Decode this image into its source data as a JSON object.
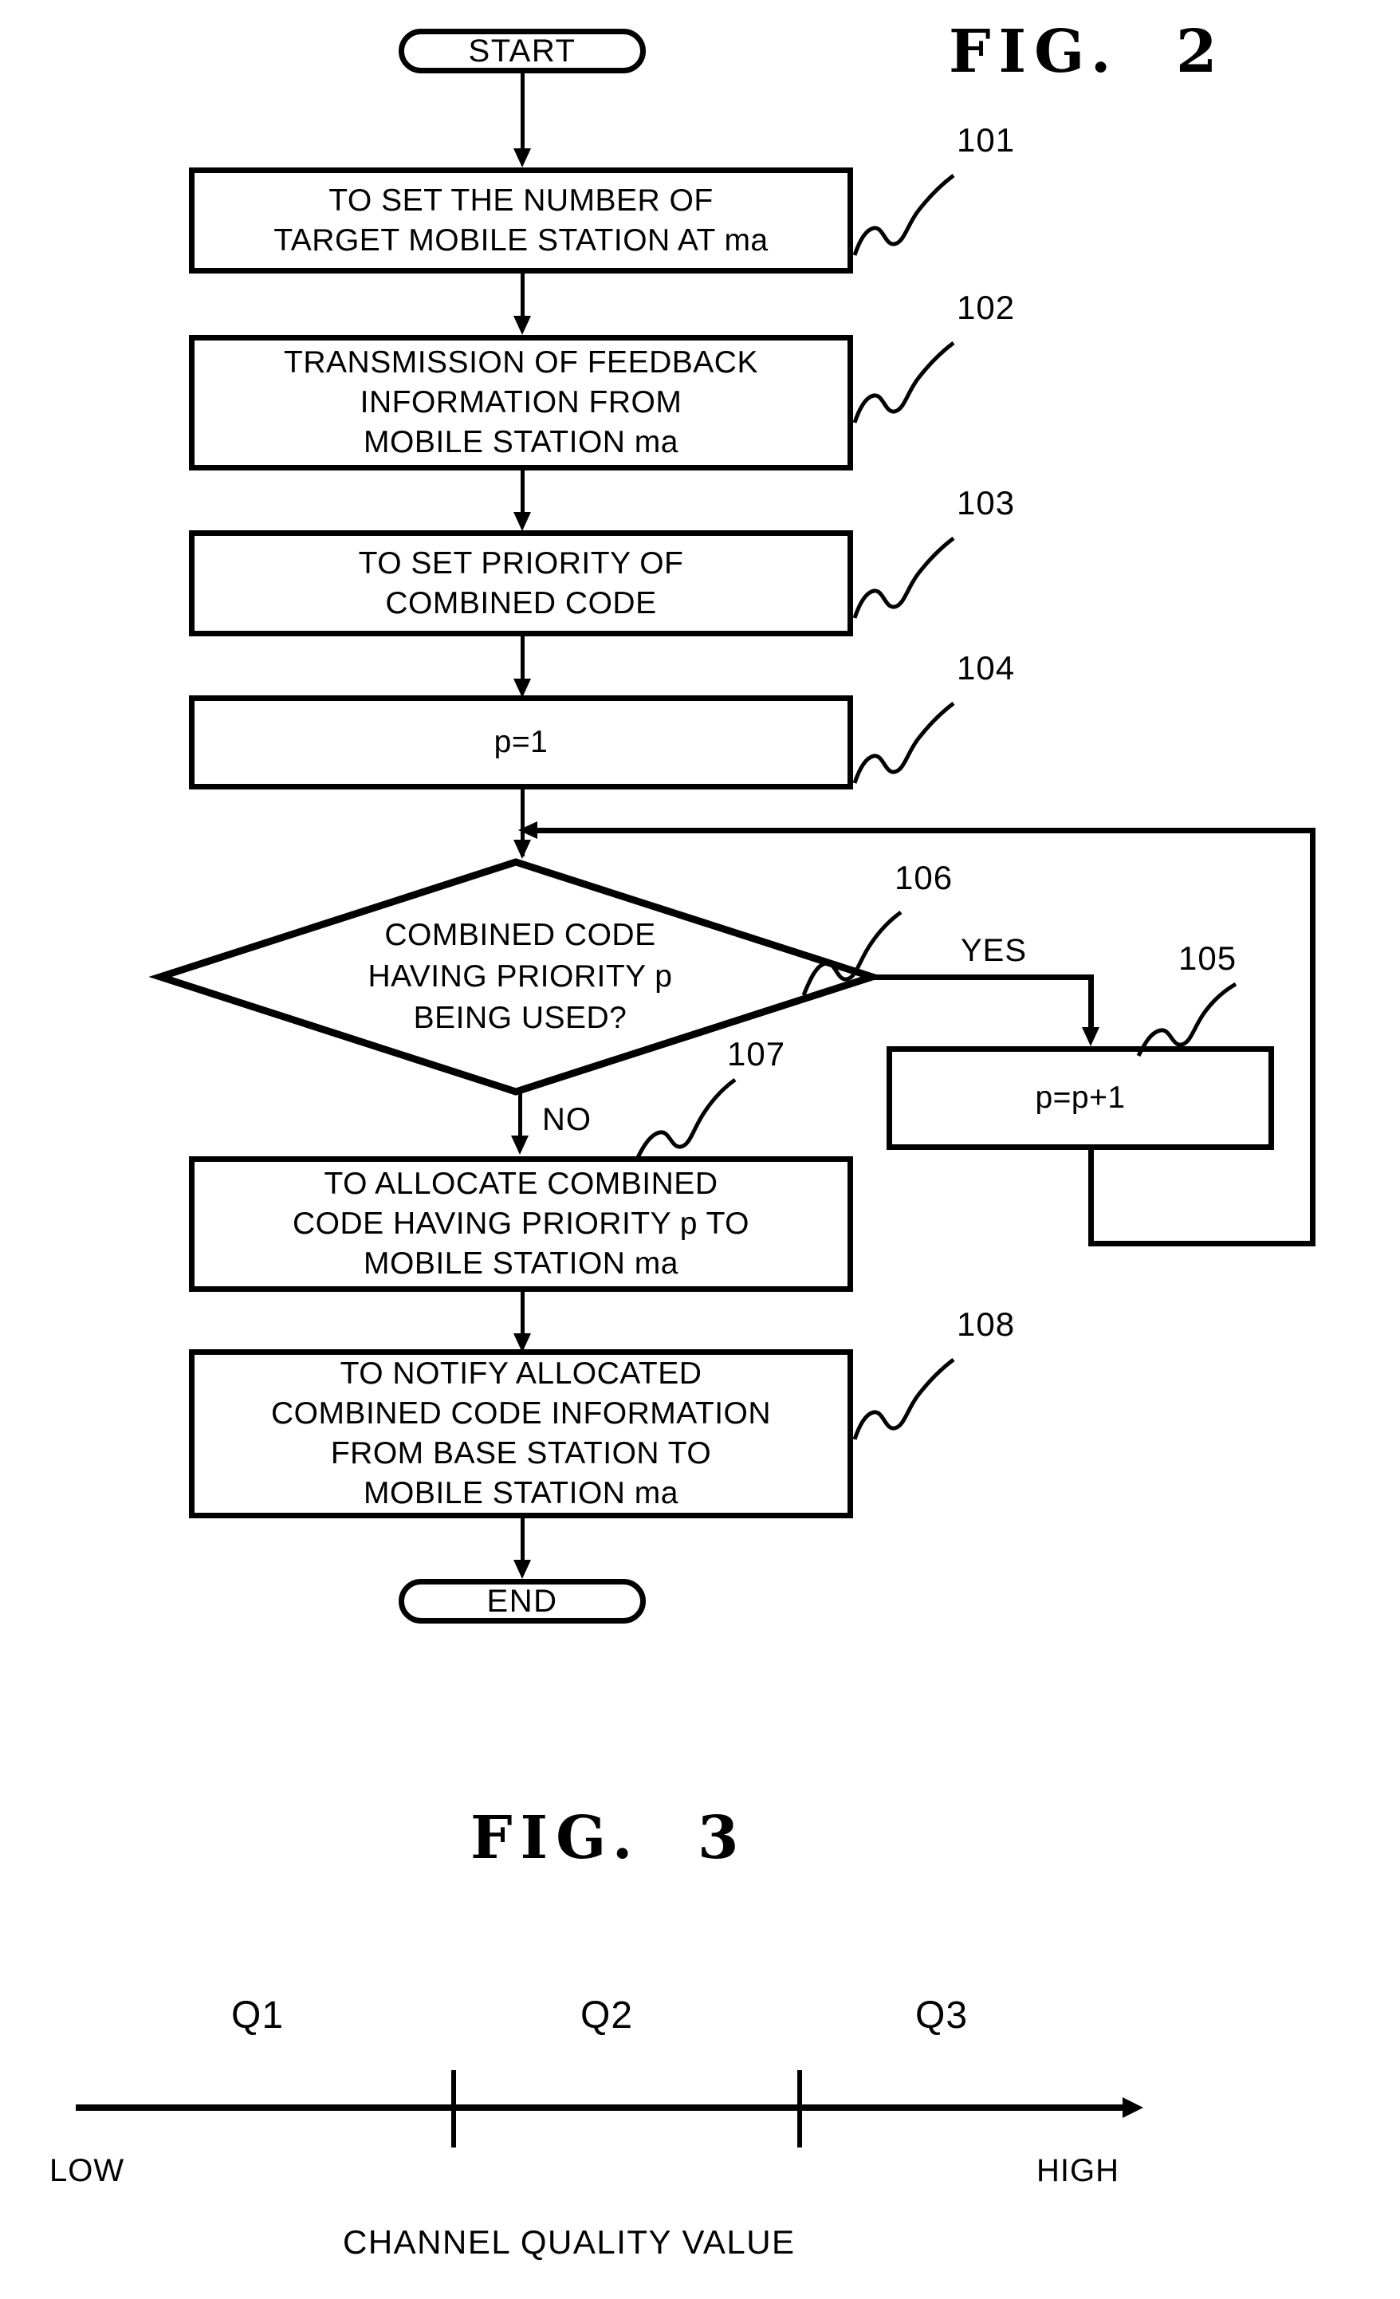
{
  "figures": [
    {
      "title": "FIG.  2",
      "type": "flowchart"
    },
    {
      "title": "FIG.  3",
      "type": "axis-diagram"
    }
  ],
  "flowchart": {
    "title": "FIG.  2",
    "start_label": "START",
    "end_label": "END",
    "yes_label": "YES",
    "no_label": "NO",
    "steps": [
      {
        "ref": "101",
        "shape": "process",
        "text": "TO SET THE NUMBER OF\nTARGET MOBILE STATION AT ma"
      },
      {
        "ref": "102",
        "shape": "process",
        "text": "TRANSMISSION OF FEEDBACK\nINFORMATION FROM\nMOBILE STATION ma"
      },
      {
        "ref": "103",
        "shape": "process",
        "text": "TO SET PRIORITY OF\nCOMBINED CODE"
      },
      {
        "ref": "104",
        "shape": "process",
        "text": "p=1"
      },
      {
        "ref": "106",
        "shape": "decision",
        "text": "COMBINED CODE\nHAVING PRIORITY p\nBEING USED?"
      },
      {
        "ref": "105",
        "shape": "process",
        "text": "p=p+1"
      },
      {
        "ref": "107",
        "shape": "process",
        "text": "TO ALLOCATE COMBINED\nCODE HAVING PRIORITY p TO\nMOBILE STATION ma"
      },
      {
        "ref": "108",
        "shape": "process",
        "text": "TO NOTIFY ALLOCATED\nCOMBINED CODE INFORMATION\nFROM BASE STATION TO\nMOBILE STATION ma"
      }
    ]
  },
  "axis_diagram": {
    "title": "FIG.  3",
    "caption": "CHANNEL QUALITY VALUE",
    "low_label": "LOW",
    "high_label": "HIGH",
    "regions": [
      {
        "label": "Q1"
      },
      {
        "label": "Q2"
      },
      {
        "label": "Q3"
      }
    ]
  },
  "chart_data": {
    "type": "line",
    "title": "FIG.  3",
    "xlabel": "CHANNEL QUALITY VALUE",
    "axis_min_label": "LOW",
    "axis_max_label": "HIGH",
    "categories": [
      "Q1",
      "Q2",
      "Q3"
    ],
    "boundaries": [
      0.35,
      0.67
    ],
    "xlim": [
      0,
      1
    ],
    "grid": false,
    "legend": "none",
    "annotations": [
      "Q1",
      "Q2",
      "Q3",
      "LOW",
      "HIGH",
      "CHANNEL QUALITY VALUE"
    ]
  },
  "colors": {
    "ink": "#000000",
    "paper": "#ffffff"
  }
}
